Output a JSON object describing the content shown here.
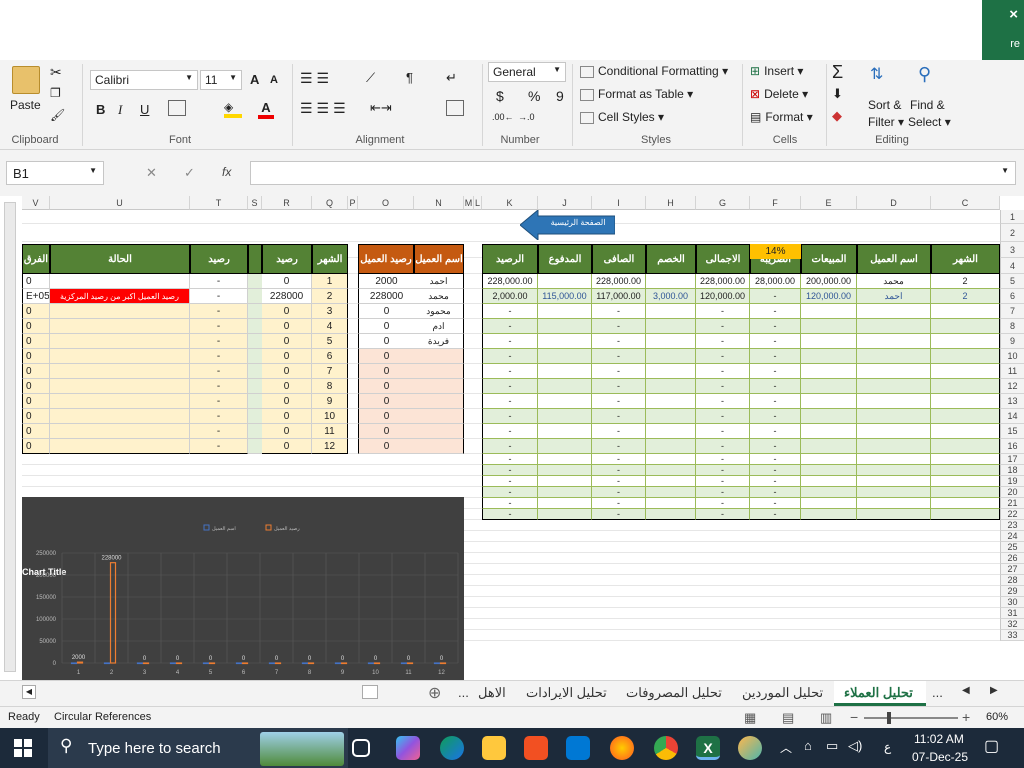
{
  "window": {
    "close_glyph": "×",
    "corner_text": "re"
  },
  "ribbon": {
    "clipboard": {
      "paste": "Paste",
      "label": "Clipboard"
    },
    "font": {
      "name": "Calibri",
      "size": "11",
      "label": "Font",
      "bold": "B",
      "italic": "I",
      "underline": "U",
      "grow": "A",
      "shrink": "A",
      "color_letter": "A"
    },
    "alignment": {
      "label": "Alignment"
    },
    "number": {
      "format": "General",
      "currency": "$",
      "percent": "%",
      "comma": "9",
      "label": "Number"
    },
    "styles": {
      "conditional": "Conditional Formatting",
      "table": "Format as Table",
      "cell": "Cell Styles",
      "label": "Styles"
    },
    "cells": {
      "insert": "Insert",
      "delete": "Delete",
      "format": "Format",
      "label": "Cells"
    },
    "editing": {
      "sort": "Sort &",
      "sort2": "Filter",
      "find": "Find &",
      "find2": "Select",
      "label": "Editing"
    }
  },
  "formula_bar": {
    "name_box": "B1",
    "cancel": "✕",
    "enter": "✓",
    "fx": "fx",
    "value": ""
  },
  "columns": {
    "left": [
      "V",
      "U",
      "T",
      "S",
      "R",
      "Q",
      "P",
      "O",
      "N",
      "M",
      "L"
    ],
    "right": [
      "K",
      "J",
      "I",
      "H",
      "G",
      "F",
      "E",
      "D",
      "C"
    ]
  },
  "rows": [
    "1",
    "2",
    "3",
    "4",
    "5",
    "6",
    "7",
    "8",
    "9",
    "10",
    "11",
    "12",
    "13",
    "14",
    "15",
    "16",
    "17",
    "18",
    "19",
    "20",
    "21",
    "22",
    "23",
    "24",
    "25",
    "26",
    "27",
    "28",
    "29",
    "30",
    "31",
    "32",
    "33"
  ],
  "home_button": "الصفحة الرئيسية",
  "tax_rate": "14%",
  "right_table": {
    "headers": [
      "الرصيد",
      "المدفوع",
      "الصافى",
      "الخصم",
      "الاجمالى",
      "الضريبة",
      "المبيعات",
      "اسم العميل",
      "الشهر"
    ],
    "row5": [
      "228,000.00",
      "",
      "228,000.00",
      "",
      "228,000.00",
      "28,000.00",
      "200,000.00",
      "محمد",
      "2"
    ],
    "row6": [
      "2,000.00",
      "115,000.00",
      "117,000.00",
      "3,000.00",
      "120,000.00",
      "-",
      "120,000.00",
      "احمد",
      "2"
    ],
    "dash": "-"
  },
  "customer_table": {
    "headers": [
      "اسم العميل",
      "رصيد العميل"
    ],
    "rows": [
      [
        "احمد",
        "2000"
      ],
      [
        "محمد",
        "228000"
      ],
      [
        "محمود",
        "0"
      ],
      [
        "ادم",
        "0"
      ],
      [
        "فريدة",
        "0"
      ],
      [
        "",
        "0"
      ],
      [
        "",
        "0"
      ],
      [
        "",
        "0"
      ],
      [
        "",
        "0"
      ],
      [
        "",
        "0"
      ],
      [
        "",
        "0"
      ],
      [
        "",
        "0"
      ]
    ]
  },
  "monthly_table": {
    "headers": [
      "الفرق",
      "الحالة",
      "رصيد المركزية",
      "رصيد الشهر",
      "الشهر"
    ],
    "rows": [
      [
        "0",
        "",
        "-",
        "0",
        "1"
      ],
      [
        "E+05",
        "رصيد العميل اكبر من رصيد المركزية",
        "-",
        "228000",
        "2"
      ],
      [
        "0",
        "",
        "-",
        "0",
        "3"
      ],
      [
        "0",
        "",
        "-",
        "0",
        "4"
      ],
      [
        "0",
        "",
        "-",
        "0",
        "5"
      ],
      [
        "0",
        "",
        "-",
        "0",
        "6"
      ],
      [
        "0",
        "",
        "-",
        "0",
        "7"
      ],
      [
        "0",
        "",
        "-",
        "0",
        "8"
      ],
      [
        "0",
        "",
        "-",
        "0",
        "9"
      ],
      [
        "0",
        "",
        "-",
        "0",
        "10"
      ],
      [
        "0",
        "",
        "-",
        "0",
        "11"
      ],
      [
        "0",
        "",
        "-",
        "0",
        "12"
      ]
    ]
  },
  "chart_data": {
    "type": "bar",
    "title": "Chart Title",
    "categories": [
      "1",
      "2",
      "3",
      "4",
      "5",
      "6",
      "7",
      "8",
      "9",
      "10",
      "11",
      "12"
    ],
    "series": [
      {
        "name": "اسم العميل",
        "values": [
          0,
          0,
          0,
          0,
          0,
          0,
          0,
          0,
          0,
          0,
          0,
          0
        ]
      },
      {
        "name": "رصيد العميل",
        "values": [
          2000,
          228000,
          0,
          0,
          0,
          0,
          0,
          0,
          0,
          0,
          0,
          0
        ]
      }
    ],
    "ylim": [
      0,
      250000
    ],
    "yticks": [
      "0",
      "50000",
      "100000",
      "150000",
      "200000",
      "250000"
    ],
    "data_labels": [
      "2000",
      "228000",
      "0",
      "0",
      "0",
      "0",
      "0",
      "0",
      "0",
      "0",
      "0",
      "0"
    ],
    "colors": {
      "series1": "#4472c4",
      "series2": "#ed7d31"
    }
  },
  "sheet_tabs": [
    "تحليل العملاء",
    "تحليل الموردين",
    "تحليل المصروفات",
    "تحليل الايرادات",
    "الاهل"
  ],
  "sheet_tabs_more": "...",
  "status": {
    "ready": "Ready",
    "circular": "Circular References",
    "zoom": "60%"
  },
  "taskbar": {
    "search": "Type here to search",
    "time": "11:02 AM",
    "date": "07-Dec-25",
    "lang": "ع"
  }
}
